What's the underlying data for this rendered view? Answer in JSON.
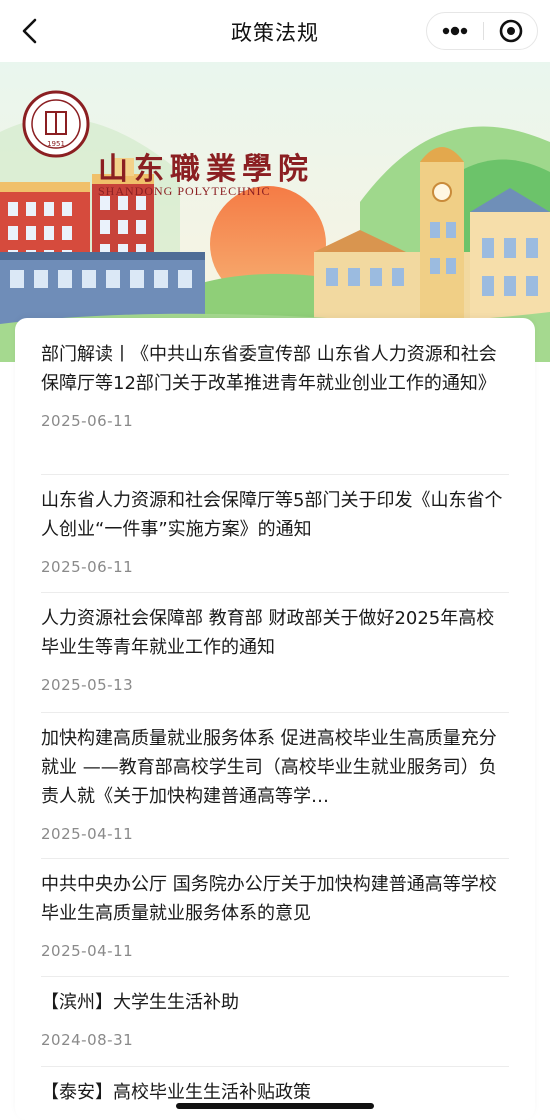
{
  "navbar": {
    "title": "政策法规",
    "back_icon": "chevron-left-icon",
    "more_icon": "more-dots-icon",
    "close_icon": "target-close-icon"
  },
  "banner": {
    "school_name_cn": "山东職業學院",
    "school_name_en": "SHANDONG POLYTECHNIC",
    "seal_year": "1951",
    "colors": {
      "sky": "#dff0d8",
      "sun": "#f2834f",
      "hill": "#8ccf7e",
      "brick": "#c94b3c",
      "sand": "#f1d28a"
    }
  },
  "articles": [
    {
      "title": "部门解读丨《中共山东省委宣传部 山东省人力资源和社会保障厅等12部门关于改革推进青年就业创业工作的通知》",
      "date": "2025-06-11"
    },
    {
      "title": "山东省人力资源和社会保障厅等5部门关于印发《山东省个人创业“一件事”实施方案》的通知",
      "date": "2025-06-11"
    },
    {
      "title": "人力资源社会保障部 教育部 财政部关于做好2025年高校毕业生等青年就业工作的通知",
      "date": "2025-05-13"
    },
    {
      "title": "加快构建高质量就业服务体系 促进高校毕业生高质量充分就业 ——教育部高校学生司（高校毕业生就业服务司）负责人就《关于加快构建普通高等学…",
      "date": "2025-04-11"
    },
    {
      "title": "中共中央办公厅 国务院办公厅关于加快构建普通高等学校毕业生高质量就业服务体系的意见",
      "date": "2025-04-11"
    },
    {
      "title": "【滨州】大学生生活补助",
      "date": "2024-08-31"
    },
    {
      "title": "【泰安】高校毕业生生活补贴政策",
      "date": ""
    }
  ]
}
